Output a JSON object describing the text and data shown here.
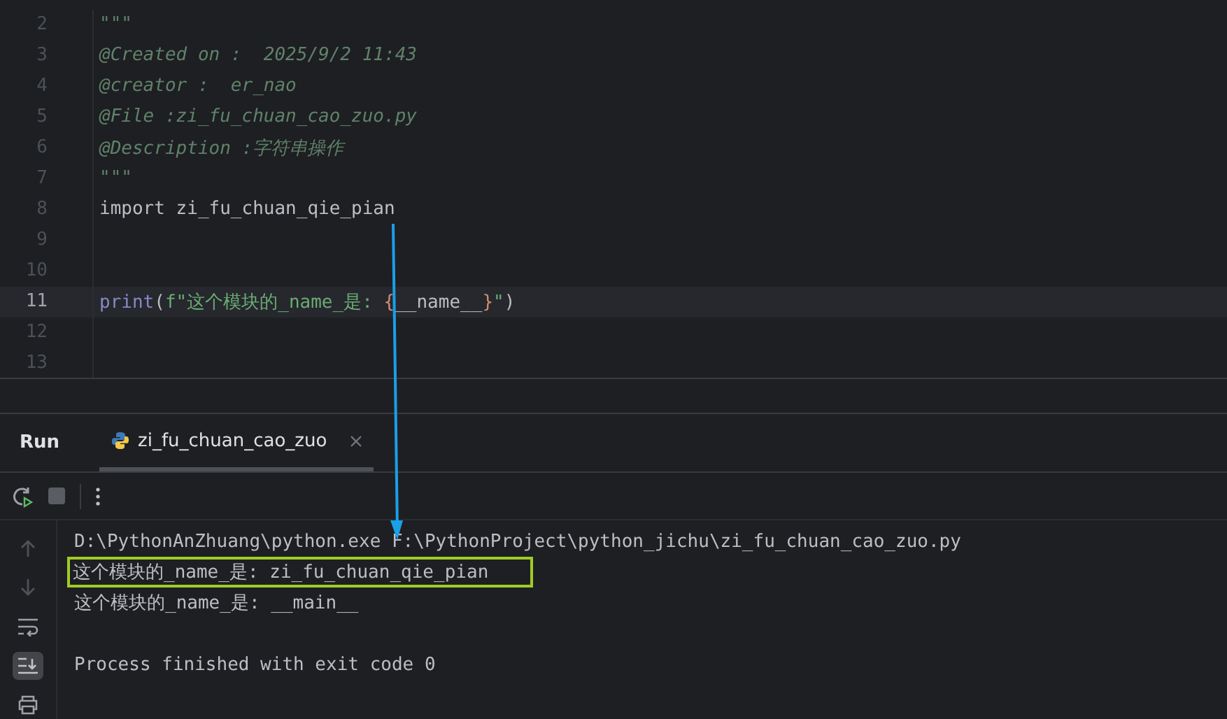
{
  "editor": {
    "lines": [
      {
        "number": "2",
        "current": false,
        "tokens": [
          {
            "kind": "doc",
            "text": "\"\"\""
          }
        ]
      },
      {
        "number": "3",
        "current": false,
        "tokens": [
          {
            "kind": "doc",
            "text": "@Created on :  2025/9/2 11:43"
          }
        ]
      },
      {
        "number": "4",
        "current": false,
        "tokens": [
          {
            "kind": "doc",
            "text": "@creator :  er_nao"
          }
        ]
      },
      {
        "number": "5",
        "current": false,
        "tokens": [
          {
            "kind": "doc",
            "text": "@File :zi_fu_chuan_cao_zuo.py"
          }
        ]
      },
      {
        "number": "6",
        "current": false,
        "tokens": [
          {
            "kind": "doc",
            "text": "@Description :字符串操作"
          }
        ]
      },
      {
        "number": "7",
        "current": false,
        "tokens": [
          {
            "kind": "doc",
            "text": "\"\"\""
          }
        ]
      },
      {
        "number": "8",
        "current": false,
        "tokens": [
          {
            "kind": "plain",
            "text": "import zi_fu_chuan_qie_pian"
          }
        ]
      },
      {
        "number": "9",
        "current": false
      },
      {
        "number": "10",
        "current": false
      },
      {
        "number": "11",
        "current": true,
        "tokens": [
          {
            "kind": "builtin",
            "text": "print"
          },
          {
            "kind": "plain",
            "text": "("
          },
          {
            "kind": "string",
            "text": "f\"这个模块的_name_是: "
          },
          {
            "kind": "brace",
            "text": "{"
          },
          {
            "kind": "plain",
            "text": "__name__"
          },
          {
            "kind": "brace",
            "text": "}"
          },
          {
            "kind": "string",
            "text": "\""
          },
          {
            "kind": "plain",
            "text": ")"
          }
        ]
      },
      {
        "number": "12",
        "current": false
      },
      {
        "number": "13",
        "current": false
      }
    ]
  },
  "run_panel": {
    "title": "Run",
    "tabs": [
      {
        "label": "zi_fu_chuan_cao_zuo",
        "selected": true
      }
    ],
    "output": [
      {
        "kind": "command",
        "text": "D:\\PythonAnZhuang\\python.exe F:\\PythonProject\\python_jichu\\zi_fu_chuan_cao_zuo.py",
        "highlighted": false
      },
      {
        "kind": "output",
        "text": "这个模块的_name_是: zi_fu_chuan_qie_pian",
        "highlighted": true
      },
      {
        "kind": "output",
        "text": "这个模块的_name_是: __main__",
        "highlighted": false
      },
      {
        "kind": "exit",
        "text": "Process finished with exit code 0",
        "highlighted": false
      }
    ]
  }
}
